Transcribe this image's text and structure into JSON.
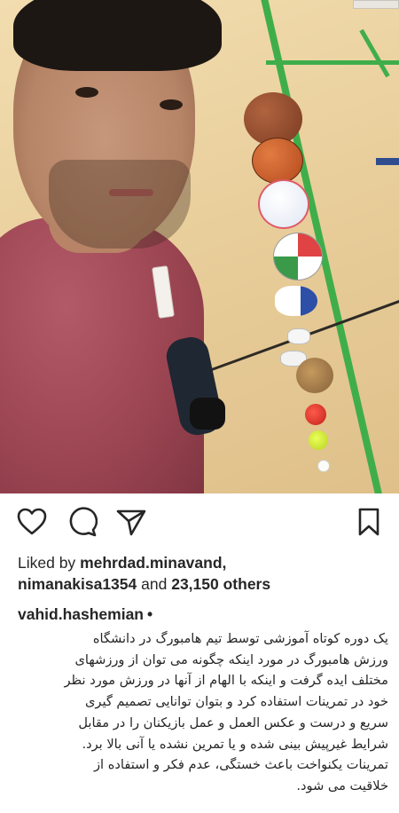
{
  "post": {
    "likes": {
      "prefix": "Liked by",
      "first_user": "mehrdad.minavand",
      "second_user": "nimanakisa1354",
      "connector": "and",
      "others": "23,150 others"
    },
    "author": {
      "username": "vahid.hashemian",
      "separator": "•"
    },
    "caption_lines": [
      "یک دوره کوتاه آموزشی  توسط تیم هامبورگ در دانشگاه",
      "ورزش هامبورگ در مورد اینکه چگونه می توان از ورزشهای",
      "مختلف ایده گرفت و اینکه با الهام از آنها در ورزش مورد نظر",
      "خود در تمرینات استفاده کرد و بتوان توانایی تصمیم گیری",
      "سریع و درست و عکس العمل و عمل بازیکنان را در مقابل",
      "شرایط غیرپیش بینی شده و یا تمرین نشده یا آنی بالا برد.",
      "تمرینات یکنواخت باعث خستگی، عدم فکر و استفاده از",
      "خلاقیت می شود."
    ]
  },
  "icons": {
    "like": "heart-outline-icon",
    "comment": "comment-bubble-icon",
    "share": "paper-plane-icon",
    "save": "bookmark-icon"
  },
  "colors": {
    "text": "#262626",
    "court_line": "#3fae4a",
    "shirt": "#9c4552"
  }
}
